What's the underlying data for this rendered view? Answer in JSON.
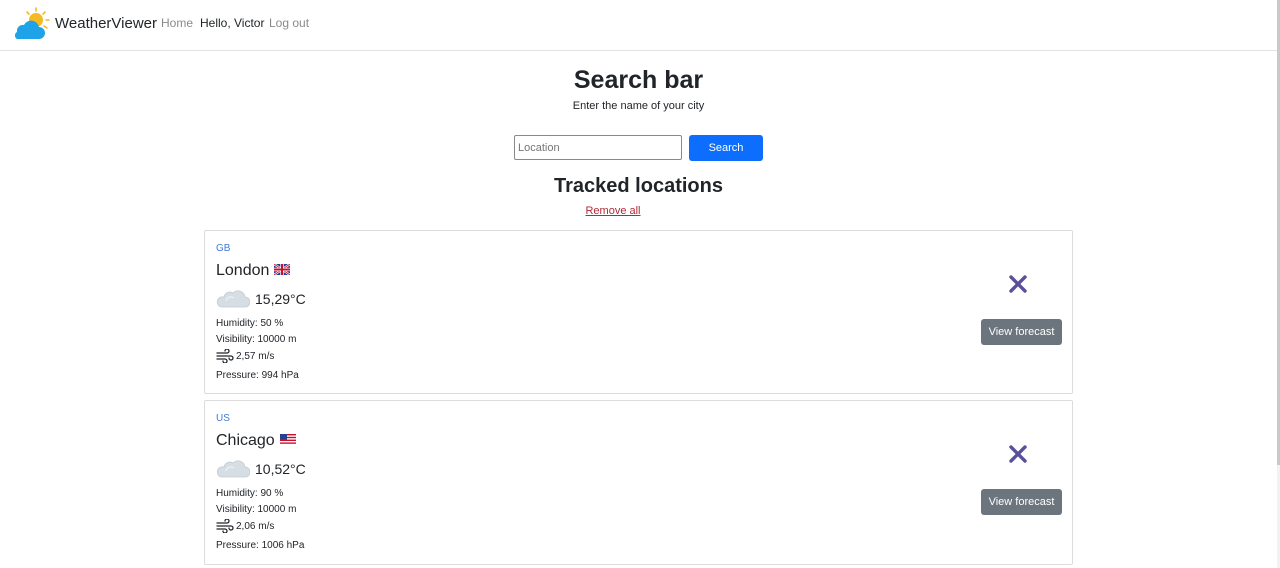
{
  "nav": {
    "brand": "WeatherViewer",
    "home": "Home",
    "greeting": "Hello, Victor",
    "logout": "Log out"
  },
  "search": {
    "title": "Search bar",
    "subtitle": "Enter the name of your city",
    "placeholder": "Location",
    "button": "Search"
  },
  "tracked": {
    "title": "Tracked locations",
    "remove_all": "Remove all",
    "locations": [
      {
        "country": "GB",
        "city": "London",
        "temp": "15,29°C",
        "humidity": "Humidity: 50 %",
        "visibility": "Visibility: 10000 m",
        "wind": "2,57 m/s",
        "pressure": "Pressure: 994 hPa",
        "forecast_button": "View forecast"
      },
      {
        "country": "US",
        "city": "Chicago",
        "temp": "10,52°C",
        "humidity": "Humidity: 90 %",
        "visibility": "Visibility: 10000 m",
        "wind": "2,06 m/s",
        "pressure": "Pressure: 1006 hPa",
        "forecast_button": "View forecast"
      }
    ]
  },
  "icons": {
    "logo": "sun-cloud-icon",
    "weather": "cloud-icon",
    "wind": "wind-icon",
    "remove": "close-icon",
    "flags": [
      "uk-flag-icon",
      "us-flag-icon"
    ]
  },
  "colors": {
    "primary": "#0d6efd",
    "secondary": "#6c757d",
    "danger_link": "#b02a37",
    "country_label": "#3d7bd9",
    "close_icon": "#5a4f9a"
  }
}
